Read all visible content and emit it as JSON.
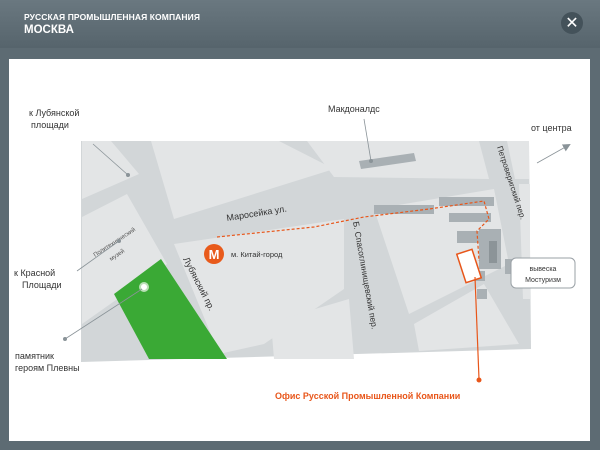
{
  "header": {
    "company": "РУССКАЯ ПРОМЫШЛЕННАЯ КОМПАНИЯ",
    "city": "МОСКВА",
    "close_symbol": "✕"
  },
  "map": {
    "labels": {
      "lubyanka_line1": "к Лубянской",
      "lubyanka_line2": "площади",
      "mcdonalds": "Макдоналдс",
      "center": "от центра",
      "red_square_line1": "к Красной",
      "red_square_line2": "Площади",
      "monument_line1": "памятник",
      "monument_line2": "героям Плевны",
      "museum_line1": "Политехнический",
      "museum_line2": "музей",
      "maroseyka": "Маросейка ул.",
      "lubyansky": "Лубянский пр.",
      "spasoglinishchevsky": "Б. Спасоглинищевский пер.",
      "petroverigsky": "Петроверигский пер.",
      "metro_letter": "М",
      "metro_name": "м. Китай-город",
      "sign_line1": "вывеска",
      "sign_line2": "Мостуризм",
      "office": "Офис Русской Промышленной Компании"
    },
    "colors": {
      "road": "#d2d6d8",
      "block": "#e3e5e6",
      "building": "#a9b0b4",
      "park": "#3aa935",
      "metro": "#e85a1b",
      "route": "#e8561a",
      "office_text": "#e8561a",
      "label": "#333333"
    }
  }
}
